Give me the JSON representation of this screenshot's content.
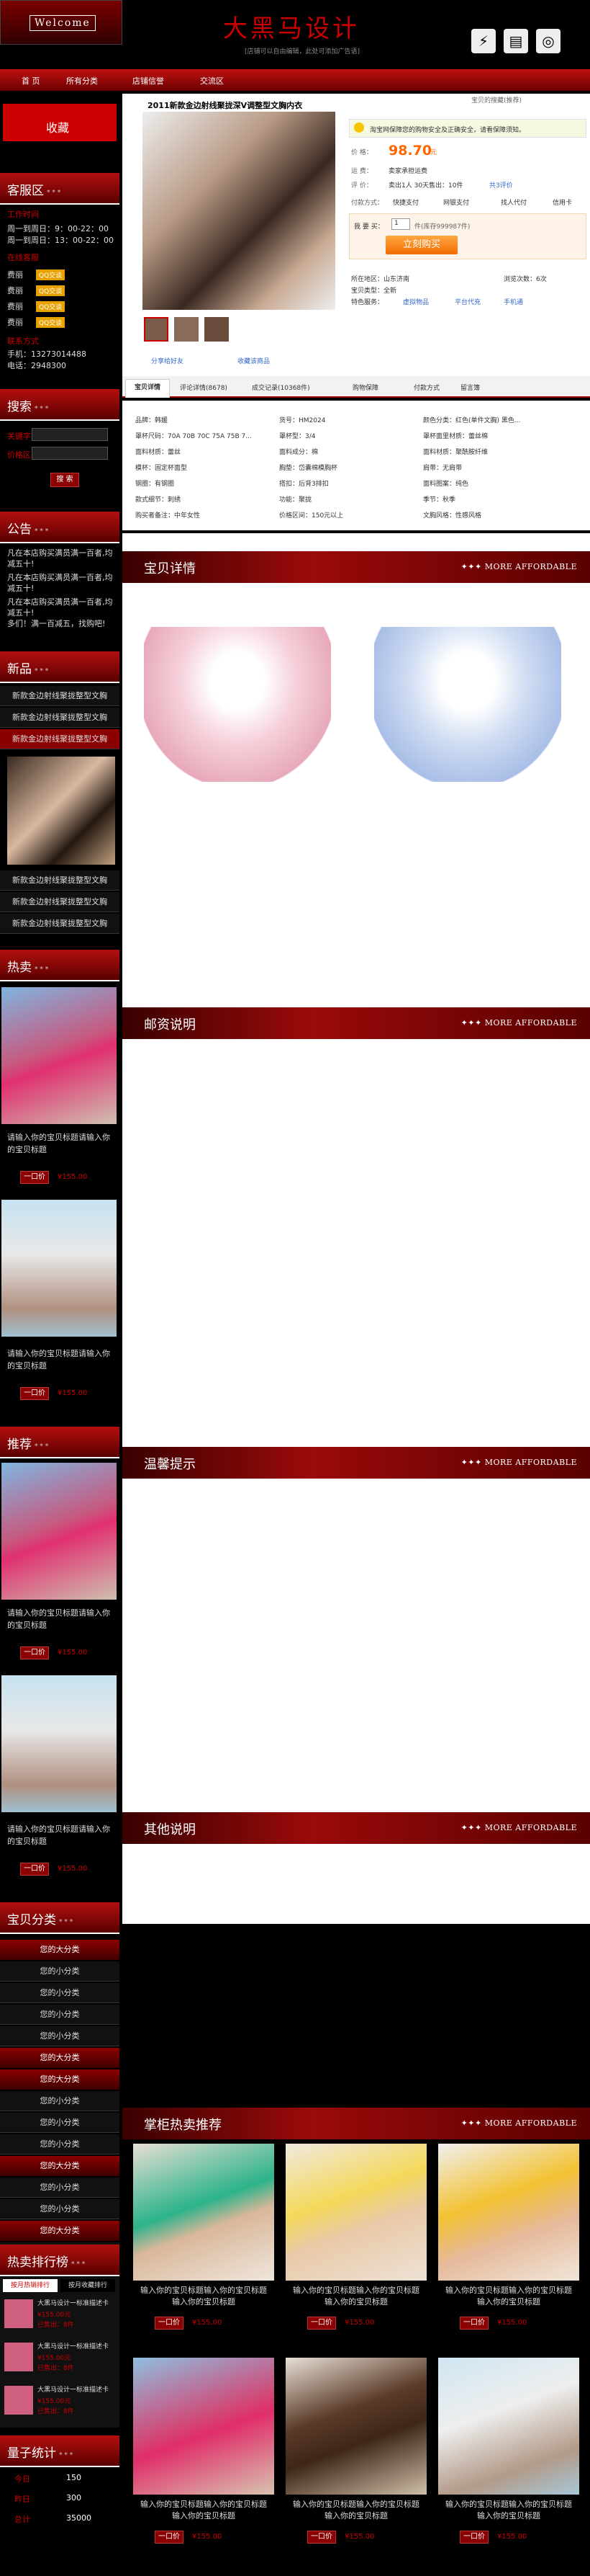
{
  "header": {
    "welcome": "Welcome",
    "logo": "大黑马设计",
    "tagline": "[店铺可以自由编辑，此处可添加广告语]"
  },
  "nav": [
    "首 页",
    "所有分类",
    "店铺信誉",
    "交流区"
  ],
  "sidebar": {
    "collect": "收藏",
    "service": {
      "title": "客服区",
      "sub": "* * *",
      "hours_label": "工作时间",
      "hours": [
        "周一到周日：9：00-22：00",
        "周一到周日：13：00-22：00"
      ],
      "qq_label": "在线客服",
      "qq": [
        "费丽",
        "费丽",
        "费丽",
        "费丽"
      ],
      "badge": "QQ交谈",
      "contact_label": "联系方式",
      "phone": "手机：13273014488",
      "tel": "电话：2948300"
    },
    "search": {
      "title": "搜索",
      "sub": "* * *",
      "kw": "关键字",
      "price": "价格区间",
      "btn": "搜 索"
    },
    "notice": {
      "title": "公告",
      "sub": "* * *",
      "text": [
        "凡在本店购买满员满一百者,均减五十!",
        "凡在本店购买满员满一百者,均减五十!",
        "凡在本店购买满员满一百者,均减五十!",
        "凡在本店购买满员满一百者,均减五十!",
        "多们！满一百减五，找购吧!"
      ]
    },
    "newitems": {
      "title": "新品",
      "sub": "* * *",
      "items": [
        "新款金边射线聚拢整型文胸",
        "新款金边射线聚拢整型文胸",
        "新款金边射线聚拢整型文胸",
        "新款金边射线聚拢整型文胸",
        "新款金边射线聚拢整型文胸",
        "新款金边射线聚拢整型文胸"
      ]
    },
    "hot": {
      "title": "热卖",
      "sub": "* * *",
      "desc": "请输入你的宝贝标题请输入你的宝贝标题",
      "btn": "一口价",
      "price": "¥155.00"
    },
    "rec": {
      "title": "推荐",
      "sub": "* * *",
      "desc": "请输入你的宝贝标题请输入你的宝贝标题",
      "btn": "一口价",
      "price": "¥155.00"
    },
    "cats": {
      "title": "宝贝分类",
      "sub": "* * *",
      "big": "您的大分类",
      "small": "您的小分类"
    },
    "rank": {
      "title": "热卖排行榜",
      "sub": "* * *",
      "tabs": [
        "按月热销排行",
        "按月收藏排行"
      ],
      "item": "大黑马设计一标准描述卡",
      "price": "¥155.00元",
      "sold": "已售出：8件"
    },
    "stats": {
      "title": "量子统计",
      "sub": "* * *",
      "rows": [
        [
          "今日",
          "150"
        ],
        [
          "昨日",
          "300"
        ],
        [
          "总计",
          "35000"
        ]
      ]
    }
  },
  "product": {
    "breadcrumb": "宝贝的搜藏(推荐)",
    "title": "2011新款金边射线聚拢深V调整型文胸内衣",
    "notice": "淘宝网保障您的购物安全及正确安全，请看保障须知。",
    "price_label": "价 格：",
    "price": "98.70",
    "price_unit": "元",
    "ship_label": "运 费：",
    "ship": "卖家承担运费",
    "sold_label": "评 价：",
    "sold": "卖出1人 30天售出：10件",
    "sold2": "共3评价",
    "pay_label": "付款方式：",
    "pay": [
      "快捷支付",
      "网银支付",
      "找人代付",
      "信用卡"
    ],
    "qty_label": "我 要 买：",
    "qty": "1",
    "stock": "件(库存999987件)",
    "buy": "立刻购买",
    "loc": "所在地区：山东济南",
    "view": "浏览次数：6次",
    "type": "宝贝类型：全新",
    "feat": "特色服务：",
    "feat_items": [
      "虚拟物品",
      "平台代充",
      "手机通"
    ],
    "share": "分享给好友",
    "fav": "收藏该商品",
    "tabs": [
      "宝贝详情",
      "评论详情(8678)",
      "成交记录(10368件)",
      "购物保障",
      "付款方式",
      "留言簿"
    ],
    "attrs": [
      [
        "品牌：韩媛",
        "货号：HM2024",
        "颜色分类：红色(单件文胸) 黑色..."
      ],
      [
        "罩杯尺码：70A 70B 70C 75A 75B 7...",
        "罩杯型：3/4",
        "罩杯面里材质：蕾丝棉"
      ],
      [
        "面料材质：蕾丝",
        "面料成分：棉",
        "面料材质：聚酰胺纤维"
      ],
      [
        "模杯：固定杯面型",
        "胸垫：岱囊棉模胸杯",
        "肩带：无肩带"
      ],
      [
        "钢圈：有钢圈",
        "搭扣：后背3排扣",
        "面料图案：纯色"
      ],
      [
        "款式细节：刺绣",
        "功能：聚拢",
        "季节：秋季"
      ],
      [
        "购买者备注：中年女性",
        "价格区间：150元以上",
        "文胸风格：性感风格"
      ]
    ]
  },
  "sections": {
    "detail": "宝贝详情",
    "post": "邮资说明",
    "tips": "温馨提示",
    "other": "其他说明",
    "counter": "掌柜热卖推荐",
    "more": "✦✦✦ MORE AFFORDABLE"
  },
  "grid": {
    "desc": "输入你的宝贝标题输入你的宝贝标题输入你的宝贝标题",
    "btn": "一口价",
    "price": "¥155.00"
  }
}
